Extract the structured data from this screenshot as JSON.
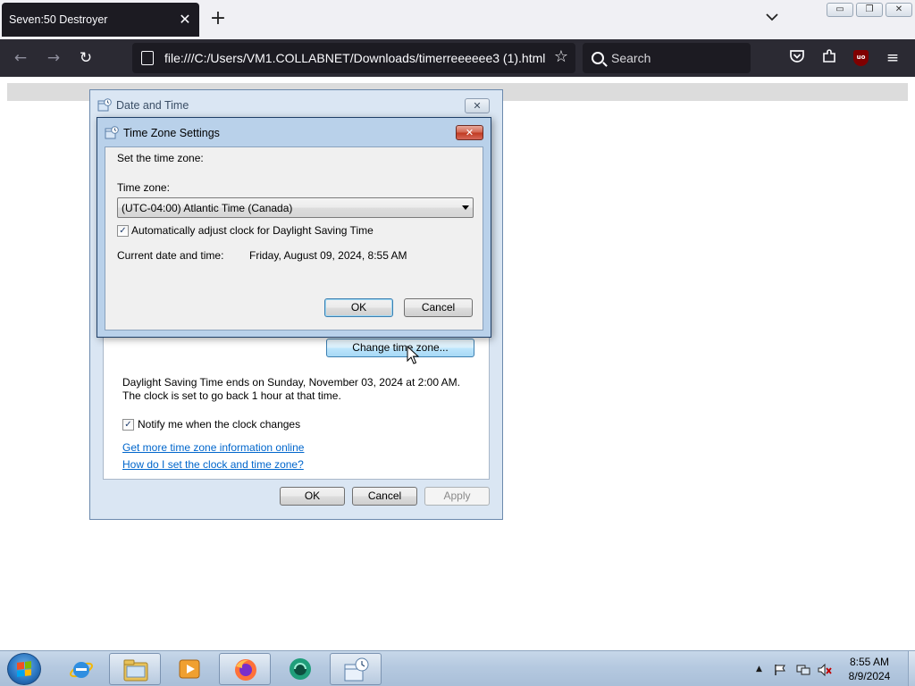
{
  "browser": {
    "tab_title": "Seven:50 Destroyer",
    "url": "file:///C:/Users/VM1.COLLABNET/Downloads/timerreeeeee3 (1).html",
    "search_placeholder": "Search",
    "ublock_label": "uo"
  },
  "date_time_dialog": {
    "title": "Date and Time",
    "change_tz_button": "Change time zone...",
    "dst_text": "Daylight Saving Time ends on Sunday, November 03, 2024 at 2:00 AM. The clock is set to go back 1 hour at that time.",
    "notify_label": "Notify me when the clock changes",
    "notify_checked": true,
    "link_more_info": "Get more time zone information online",
    "link_how_to": "How do I set the clock and time zone?",
    "ok_button": "OK",
    "cancel_button": "Cancel",
    "apply_button": "Apply"
  },
  "time_zone_dialog": {
    "title": "Time Zone Settings",
    "heading": "Set the time zone:",
    "timezone_label": "Time zone:",
    "timezone_value": "(UTC-04:00) Atlantic Time (Canada)",
    "auto_dst_label": "Automatically adjust clock for Daylight Saving Time",
    "auto_dst_checked": true,
    "current_label": "Current date and time:",
    "current_value": "Friday, August 09, 2024, 8:55 AM",
    "ok_button": "OK",
    "cancel_button": "Cancel"
  },
  "taskbar": {
    "icons": [
      "internet-explorer-icon",
      "file-explorer-icon",
      "media-player-icon",
      "firefox-icon",
      "app-icon",
      "date-time-icon"
    ],
    "clock_time": "8:55 AM",
    "clock_date": "8/9/2024"
  },
  "colors": {
    "browser_dark": "#2b2a33",
    "dialog_frame": "#dae6f3",
    "active_frame": "#b9d1ea",
    "link": "#0066cc"
  }
}
